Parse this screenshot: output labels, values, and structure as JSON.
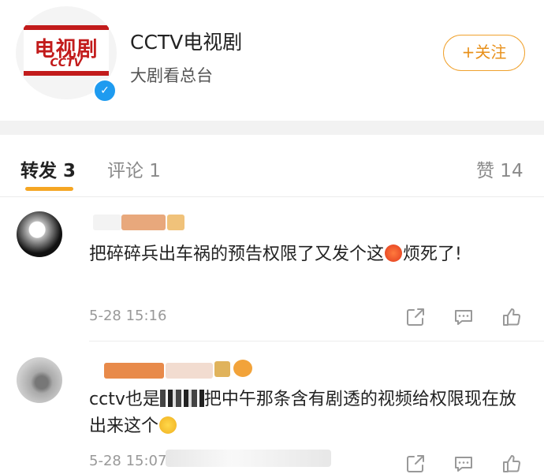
{
  "account": {
    "logo_text_cn": "电视剧",
    "logo_text_en": "CCTV",
    "name": "CCTV电视剧",
    "description": "大剧看总台",
    "follow_label": "+关注",
    "verified_icon": "verified-badge-icon"
  },
  "tabs": {
    "repost": "转发 3",
    "comment": "评论 1",
    "like": "赞 14"
  },
  "comments": [
    {
      "text_before": "把碎碎兵出车祸的预告权限了又发个这",
      "emoji": "angry-face-emoji",
      "text_after": "烦死了!",
      "time": "5-28 15:16"
    },
    {
      "text_before": "cctv也是",
      "text_middle": "把中午那条含有剧透的视频给权限现在放出来这个",
      "emoji": "crying-face-emoji",
      "time": "5-28 15:07"
    }
  ],
  "colors": {
    "accent": "#f5a623",
    "follow": "#e8901a",
    "verify": "#1e9bf0",
    "brand_red": "#c21b1b"
  }
}
